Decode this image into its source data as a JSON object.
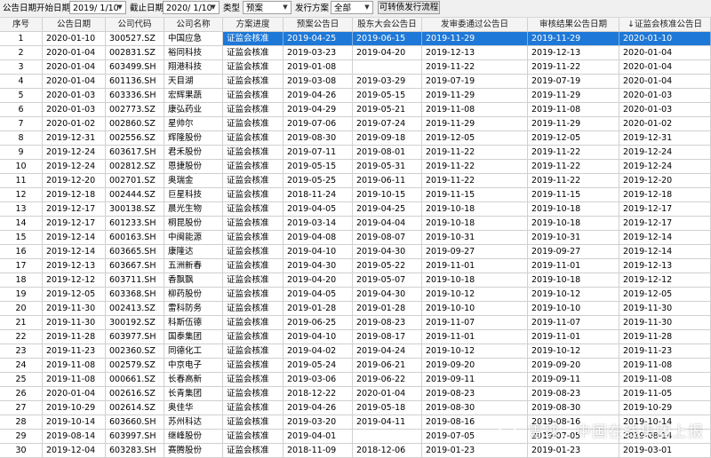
{
  "toolbar": {
    "field_label": "公告日期",
    "start_label": "开始日期",
    "start_value": "2019/ 1/10",
    "end_label": "截止日期",
    "end_value": "2020/ 1/10",
    "type_label": "类型",
    "type_value": "预案",
    "progress_label": "发行方案",
    "progress_value": "全部",
    "button_label": "可转债发行流程"
  },
  "columns": [
    "序号",
    "公告日期",
    "公司代码",
    "公司名称",
    "方案进度",
    "预案公告日",
    "股东大会公告日",
    "发审委通过公告日",
    "审核结果公告日期",
    "↓证监会核准公告日"
  ],
  "rows": [
    [
      "1",
      "2020-01-10",
      "300527.SZ",
      "中国应急",
      "证监会核准",
      "2019-04-25",
      "2019-06-15",
      "2019-11-29",
      "2019-11-29",
      "2020-01-10"
    ],
    [
      "2",
      "2020-01-04",
      "002831.SZ",
      "裕同科技",
      "证监会核准",
      "2019-03-23",
      "2019-04-20",
      "2019-12-13",
      "2019-12-13",
      "2020-01-04"
    ],
    [
      "3",
      "2020-01-04",
      "603499.SH",
      "翔港科技",
      "证监会核准",
      "2019-01-08",
      "",
      "2019-11-22",
      "2019-11-22",
      "2020-01-04"
    ],
    [
      "4",
      "2020-01-04",
      "601136.SH",
      "天目湖",
      "证监会核准",
      "2019-03-08",
      "2019-03-29",
      "2019-07-19",
      "2019-07-19",
      "2020-01-04"
    ],
    [
      "5",
      "2020-01-03",
      "603336.SH",
      "宏辉果蔬",
      "证监会核准",
      "2019-04-26",
      "2019-05-15",
      "2019-11-29",
      "2019-11-29",
      "2020-01-03"
    ],
    [
      "6",
      "2020-01-03",
      "002773.SZ",
      "康弘药业",
      "证监会核准",
      "2019-04-29",
      "2019-05-21",
      "2019-11-08",
      "2019-11-08",
      "2020-01-03"
    ],
    [
      "7",
      "2020-01-02",
      "002860.SZ",
      "星帅尔",
      "证监会核准",
      "2019-07-06",
      "2019-07-24",
      "2019-11-29",
      "2019-11-29",
      "2020-01-02"
    ],
    [
      "8",
      "2019-12-31",
      "002556.SZ",
      "辉隆股份",
      "证监会核准",
      "2019-08-30",
      "2019-09-18",
      "2019-12-05",
      "2019-12-05",
      "2019-12-31"
    ],
    [
      "9",
      "2019-12-24",
      "603617.SH",
      "君禾股份",
      "证监会核准",
      "2019-07-11",
      "2019-08-01",
      "2019-11-22",
      "2019-11-22",
      "2019-12-24"
    ],
    [
      "10",
      "2019-12-24",
      "002812.SZ",
      "恩捷股份",
      "证监会核准",
      "2019-05-15",
      "2019-05-31",
      "2019-11-22",
      "2019-11-22",
      "2019-12-24"
    ],
    [
      "11",
      "2019-12-20",
      "002701.SZ",
      "奥瑞金",
      "证监会核准",
      "2019-05-25",
      "2019-06-11",
      "2019-11-22",
      "2019-11-22",
      "2019-12-20"
    ],
    [
      "12",
      "2019-12-18",
      "002444.SZ",
      "巨星科技",
      "证监会核准",
      "2018-11-24",
      "2019-10-15",
      "2019-11-15",
      "2019-11-15",
      "2019-12-18"
    ],
    [
      "13",
      "2019-12-17",
      "300138.SZ",
      "晨光生物",
      "证监会核准",
      "2019-04-05",
      "2019-04-25",
      "2019-10-18",
      "2019-10-18",
      "2019-12-17"
    ],
    [
      "14",
      "2019-12-17",
      "601233.SH",
      "桐昆股份",
      "证监会核准",
      "2019-03-14",
      "2019-04-04",
      "2019-10-18",
      "2019-10-18",
      "2019-12-17"
    ],
    [
      "15",
      "2019-12-14",
      "600163.SH",
      "中闽能源",
      "证监会核准",
      "2019-04-08",
      "2019-08-07",
      "2019-10-31",
      "2019-10-31",
      "2019-12-14"
    ],
    [
      "16",
      "2019-12-14",
      "603665.SH",
      "康隆达",
      "证监会核准",
      "2019-04-10",
      "2019-04-30",
      "2019-09-27",
      "2019-09-27",
      "2019-12-14"
    ],
    [
      "17",
      "2019-12-13",
      "603667.SH",
      "五洲新春",
      "证监会核准",
      "2019-04-30",
      "2019-05-22",
      "2019-11-01",
      "2019-11-01",
      "2019-12-13"
    ],
    [
      "18",
      "2019-12-12",
      "603711.SH",
      "香飘飘",
      "证监会核准",
      "2019-04-20",
      "2019-05-07",
      "2019-10-18",
      "2019-10-18",
      "2019-12-12"
    ],
    [
      "19",
      "2019-12-05",
      "603368.SH",
      "柳药股份",
      "证监会核准",
      "2019-04-05",
      "2019-04-30",
      "2019-10-12",
      "2019-10-12",
      "2019-12-05"
    ],
    [
      "20",
      "2019-11-30",
      "002413.SZ",
      "雷科防务",
      "证监会核准",
      "2019-01-28",
      "2019-01-28",
      "2019-10-10",
      "2019-10-10",
      "2019-11-30"
    ],
    [
      "21",
      "2019-11-30",
      "300192.SZ",
      "科斯伍德",
      "证监会核准",
      "2019-06-25",
      "2019-08-23",
      "2019-11-07",
      "2019-11-07",
      "2019-11-30"
    ],
    [
      "22",
      "2019-11-28",
      "603977.SH",
      "国泰集团",
      "证监会核准",
      "2019-04-10",
      "2019-08-17",
      "2019-11-01",
      "2019-11-01",
      "2019-11-28"
    ],
    [
      "23",
      "2019-11-23",
      "002360.SZ",
      "同德化工",
      "证监会核准",
      "2019-04-02",
      "2019-04-24",
      "2019-10-12",
      "2019-10-12",
      "2019-11-23"
    ],
    [
      "24",
      "2019-11-08",
      "002579.SZ",
      "中京电子",
      "证监会核准",
      "2019-05-24",
      "2019-06-21",
      "2019-09-20",
      "2019-09-20",
      "2019-11-08"
    ],
    [
      "25",
      "2019-11-08",
      "000661.SZ",
      "长春高新",
      "证监会核准",
      "2019-03-06",
      "2019-06-22",
      "2019-09-11",
      "2019-09-11",
      "2019-11-08"
    ],
    [
      "26",
      "2020-01-04",
      "002616.SZ",
      "长青集团",
      "证监会核准",
      "2018-12-22",
      "2020-01-04",
      "2019-08-23",
      "2019-08-23",
      "2019-11-05"
    ],
    [
      "27",
      "2019-10-29",
      "002614.SZ",
      "奥佳华",
      "证监会核准",
      "2019-04-26",
      "2019-05-18",
      "2019-08-30",
      "2019-08-30",
      "2019-10-29"
    ],
    [
      "28",
      "2019-10-14",
      "603660.SH",
      "苏州科达",
      "证监会核准",
      "2019-03-20",
      "2019-04-11",
      "2019-08-16",
      "2019-08-16",
      "2019-10-14"
    ],
    [
      "29",
      "2019-08-14",
      "603997.SH",
      "继峰股份",
      "证监会核准",
      "2019-04-01",
      "",
      "2019-07-05",
      "2019-07-05",
      "2019-08-14"
    ],
    [
      "30",
      "2019-12-04",
      "603283.SH",
      "赛腾股份",
      "证监会核准",
      "2018-11-09",
      "2018-12-06",
      "2019-01-23",
      "2019-01-23",
      "2019-03-01"
    ]
  ],
  "selected_row": 1,
  "watermark": {
    "text": "雪球：中国在线集团上报",
    "icon": "snowball-logo-icon"
  },
  "colors": {
    "selection": "#1e78d7",
    "header_bg": "#f4f4f4",
    "toolbar_bg": "#f0f0f0",
    "grid_line": "#d0d0d0"
  }
}
